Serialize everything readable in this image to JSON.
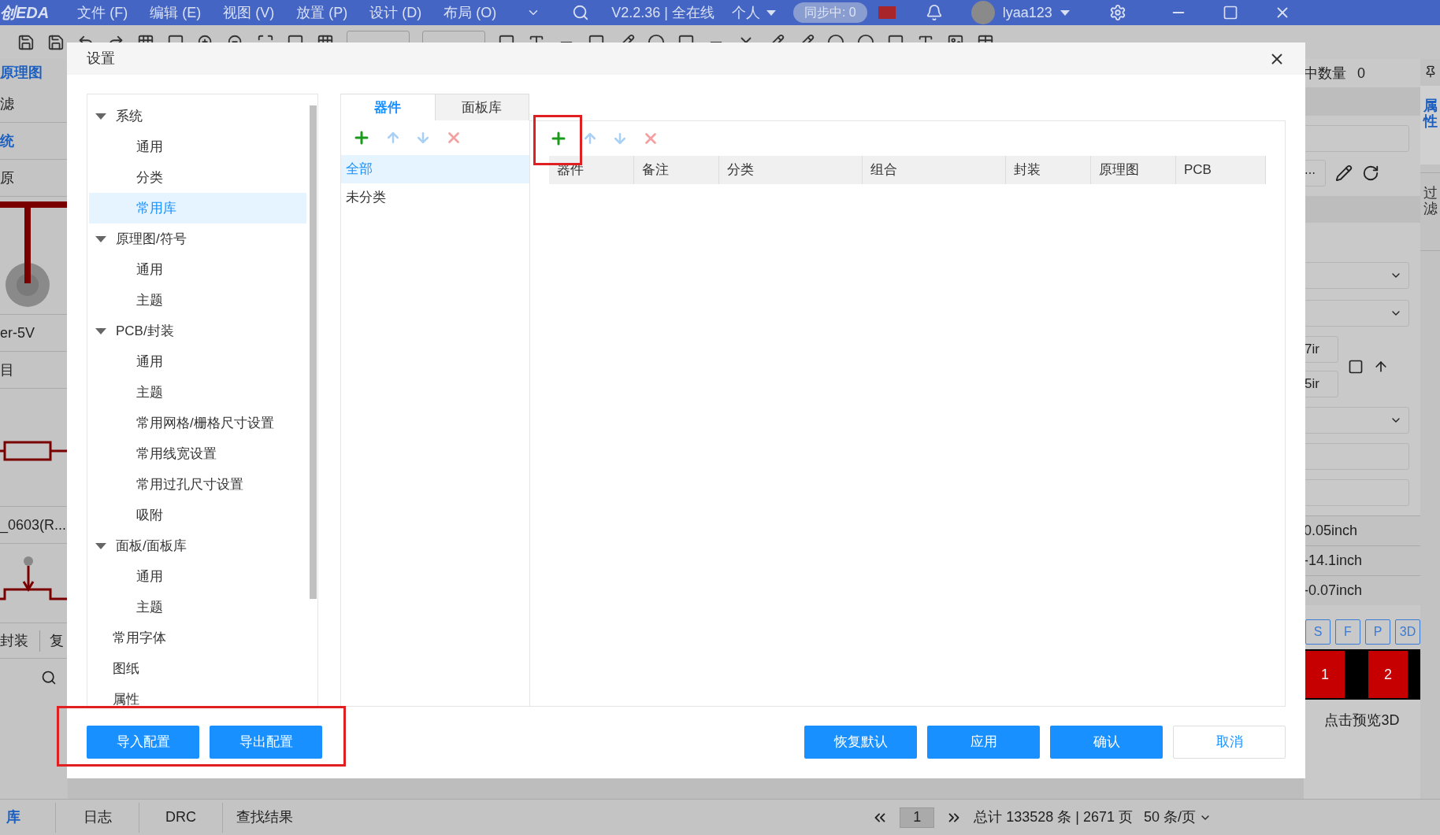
{
  "menubar": {
    "logo": "创EDA",
    "menus": [
      "文件 (F)",
      "编辑 (E)",
      "视图 (V)",
      "放置 (P)",
      "设计 (D)",
      "布局 (O)"
    ],
    "version": "V2.2.36 | 全在线",
    "mode": "个人",
    "sync": "同步中: 0",
    "user": "lyaa123"
  },
  "left_panel": {
    "items": [
      {
        "kind": "tab",
        "text": "原理图"
      },
      {
        "kind": "row",
        "text": "滤"
      },
      {
        "kind": "heading",
        "text": "统"
      },
      {
        "kind": "row",
        "text": "原"
      },
      {
        "kind": "drawing"
      },
      {
        "kind": "row",
        "text": "er-5V"
      },
      {
        "kind": "row",
        "text": "目"
      },
      {
        "kind": "drawing2"
      },
      {
        "kind": "row",
        "text": "_0603(R..."
      },
      {
        "kind": "drawing3"
      },
      {
        "kind": "tabs",
        "text": "封装"
      },
      {
        "kind": "tabs2",
        "text": "复"
      }
    ]
  },
  "right_panel": {
    "selected_count_label": "中数量",
    "selected_count": "0",
    "more_button": "⋯",
    "partial_fields": [
      "7ir",
      "5ir"
    ],
    "readings": [
      "0.05inch",
      "-14.1inch",
      "-0.07inch"
    ],
    "layer_buttons": [
      "S",
      "F",
      "P",
      "3D"
    ],
    "pads": [
      "1",
      "2"
    ],
    "preview": "点击预览3D",
    "side_tabs": [
      {
        "label": "属性",
        "selected": true
      },
      {
        "label": "过滤",
        "selected": false
      }
    ]
  },
  "bottom_bar": {
    "library_label": "库",
    "tabs": [
      "日志",
      "DRC",
      "查找结果"
    ],
    "page": "1",
    "total": "总计 133528 条 | 2671 页",
    "page_size": "50 条/页"
  },
  "dialog": {
    "title": "设置",
    "tree": [
      {
        "label": "系统",
        "expanded": true,
        "selected": false,
        "children": [
          {
            "label": "通用",
            "selected": false
          },
          {
            "label": "分类",
            "selected": false
          },
          {
            "label": "常用库",
            "selected": true
          }
        ]
      },
      {
        "label": "原理图/符号",
        "expanded": true,
        "selected": false,
        "children": [
          {
            "label": "通用",
            "selected": false
          },
          {
            "label": "主题",
            "selected": false
          }
        ]
      },
      {
        "label": "PCB/封装",
        "expanded": true,
        "selected": false,
        "children": [
          {
            "label": "通用",
            "selected": false
          },
          {
            "label": "主题",
            "selected": false
          },
          {
            "label": "常用网格/栅格尺寸设置",
            "selected": false
          },
          {
            "label": "常用线宽设置",
            "selected": false
          },
          {
            "label": "常用过孔尺寸设置",
            "selected": false
          },
          {
            "label": "吸附",
            "selected": false
          }
        ]
      },
      {
        "label": "面板/面板库",
        "expanded": true,
        "selected": false,
        "children": [
          {
            "label": "通用",
            "selected": false
          },
          {
            "label": "主题",
            "selected": false
          }
        ]
      },
      {
        "label": "常用字体",
        "selected": false
      },
      {
        "label": "图纸",
        "selected": false
      },
      {
        "label": "属性",
        "selected": false
      }
    ],
    "tabs": [
      {
        "label": "器件",
        "selected": true
      },
      {
        "label": "面板库",
        "selected": false
      }
    ],
    "categories": [
      {
        "label": "全部",
        "selected": true
      },
      {
        "label": "未分类",
        "selected": false
      }
    ],
    "table": {
      "columns": [
        "器件",
        "备注",
        "分类",
        "组合",
        "封装",
        "原理图",
        "PCB"
      ]
    },
    "left_buttons": [
      "导入配置",
      "导出配置"
    ],
    "right_buttons": [
      {
        "label": "恢复默认",
        "kind": "primary"
      },
      {
        "label": "应用",
        "kind": "primary"
      },
      {
        "label": "确认",
        "kind": "primary"
      },
      {
        "label": "取消",
        "kind": "secondary"
      }
    ]
  }
}
